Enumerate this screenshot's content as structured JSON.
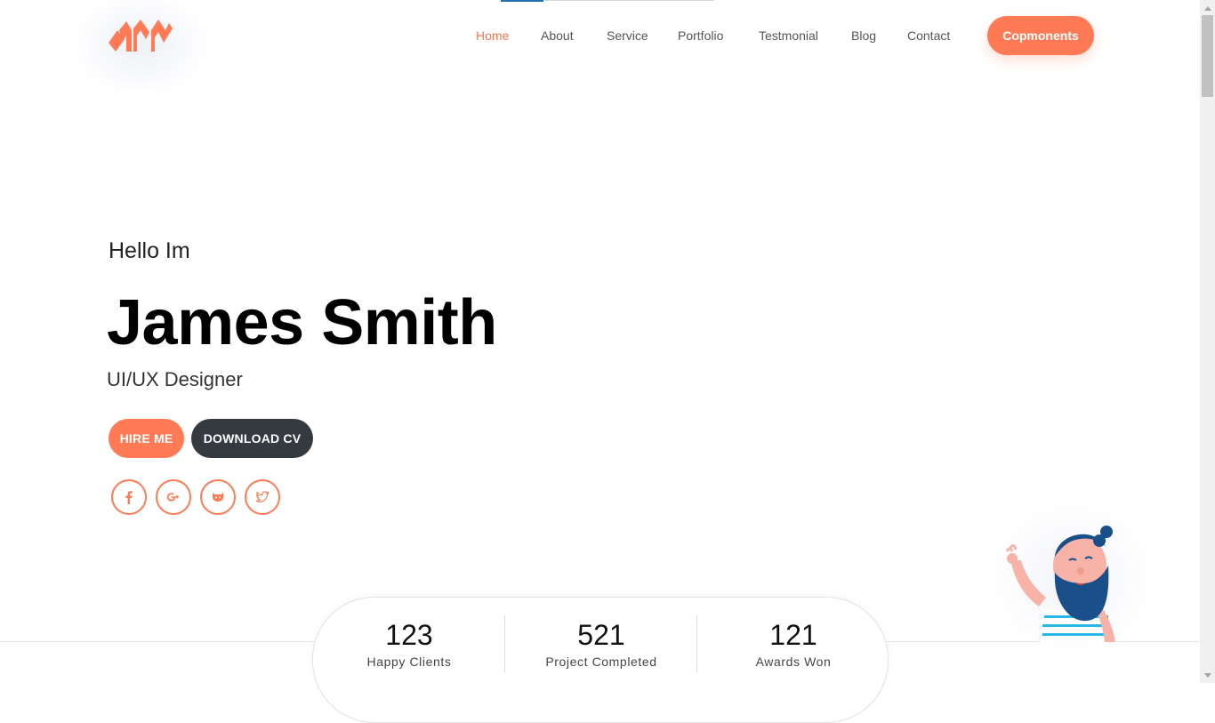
{
  "nav": {
    "items": [
      {
        "label": "Home",
        "active": true
      },
      {
        "label": "About",
        "active": false
      },
      {
        "label": "Service",
        "active": false
      },
      {
        "label": "Portfolio",
        "active": false
      },
      {
        "label": "Testmonial",
        "active": false
      },
      {
        "label": "Blog",
        "active": false
      },
      {
        "label": "Contact",
        "active": false
      }
    ],
    "cta_label": "Copmonents"
  },
  "hero": {
    "greeting": "Hello Im",
    "name": "James Smith",
    "role": "UI/UX Designer",
    "hire_label": "HIRE ME",
    "cv_label": "DOWNLOAD CV"
  },
  "social": [
    {
      "icon": "facebook-icon"
    },
    {
      "icon": "google-plus-icon"
    },
    {
      "icon": "github-icon"
    },
    {
      "icon": "twitter-icon"
    }
  ],
  "stats": [
    {
      "value": "123",
      "label": "Happy Clients"
    },
    {
      "value": "521",
      "label": "Project Completed"
    },
    {
      "value": "121",
      "label": "Awards Won"
    }
  ],
  "colors": {
    "accent": "#ff7a55",
    "dark_button": "#343a40",
    "character_hair": "#1a4f8a"
  }
}
